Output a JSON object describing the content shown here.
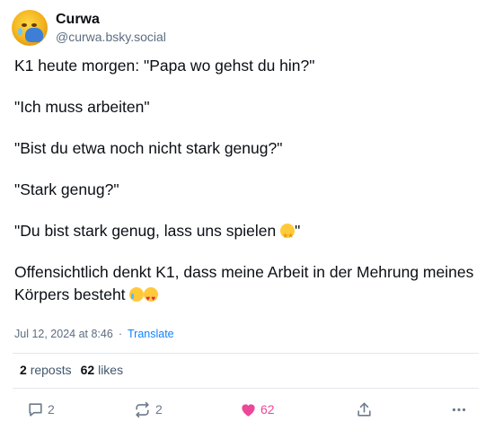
{
  "author": {
    "display_name": "Curwa",
    "handle": "@curwa.bsky.social"
  },
  "post": {
    "paragraphs": [
      "K1 heute morgen: \"Papa wo gehst du hin?\"",
      "\"Ich muss arbeiten\"",
      "\"Bist du etwa noch nicht stark genug?\"",
      "\"Stark genug?\"",
      "\"Du bist stark genug, lass uns spielen ",
      "Offensichtlich denkt K1, dass meine Arbeit in der Mehrung meines Körpers besteht "
    ],
    "quote_close": "\"",
    "emoji": {
      "star_struck": "star-struck-emoji",
      "crying": "crying-face-emoji",
      "heart_eyes": "heart-eyes-emoji"
    },
    "timestamp": "Jul 12, 2024 at 8:46",
    "separator": "·",
    "translate_label": "Translate"
  },
  "stats": {
    "reposts_count": "2",
    "reposts_label": "reposts",
    "likes_count": "62",
    "likes_label": "likes"
  },
  "actions": {
    "reply_count": "2",
    "repost_count": "2",
    "like_count": "62",
    "reply_icon": "reply-icon",
    "repost_icon": "repost-icon",
    "like_icon": "heart-icon",
    "share_icon": "share-icon",
    "more_icon": "more-icon"
  },
  "colors": {
    "like_accent": "#ec4899",
    "link": "#1083fe",
    "muted": "#5c6d80"
  }
}
